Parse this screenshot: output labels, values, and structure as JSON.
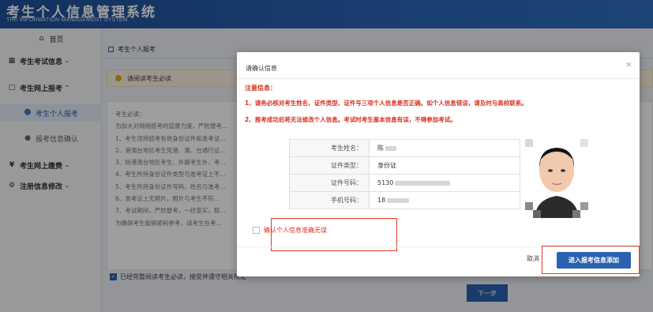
{
  "header": {
    "title_cn": "考生个人信息管理系统",
    "title_en": "THE INFORMATION MANAGEMENT SYSTEM"
  },
  "sidebar": {
    "items": [
      {
        "label": "首页",
        "icon": "home-icon"
      },
      {
        "label": "考生考试信息",
        "icon": "grid-icon"
      },
      {
        "label": "考生网上报考",
        "icon": "monitor-icon"
      },
      {
        "label": "考生个人报考",
        "icon": "user-icon"
      },
      {
        "label": "报考信息确认",
        "icon": "dot-icon"
      },
      {
        "label": "考生网上缴费",
        "icon": "yen-icon"
      },
      {
        "label": "注册信息修改",
        "icon": "gear-icon"
      }
    ]
  },
  "main": {
    "breadcrumb": "考生个人报考",
    "notice": "请阅读考生必读",
    "content_lines": [
      "考生必读：",
      "为加大对网络统考的监督力度，严防替考…",
      "1、考生须持统考有效身份证件和准考证…",
      "2、港澳台地区考生凭港、澳、台通行证…",
      "3、除港澳台地区考生、外籍考生外，考…",
      "4、考生所持身份证件类型与准考证上不…",
      "5、考生所持身份证件号码、姓名与准考…",
      "6、准考证上无照片，照片与考生不符…",
      "7、考试期间，严防替考，一经查实，取…",
      "为确保考生能够顺利参考，请考生在考…"
    ],
    "confirm_read": "已经完整阅读考生必读，接受并遵守相关规定",
    "next_button": "下一步"
  },
  "modal": {
    "title": "请确认信息",
    "attention": "注意信息：",
    "lines": [
      "1、请务必核对考生姓名、证件类型、证件号三项个人信息是否正确。如个人信息错误，请及时与高校联系。",
      "2、报考成功后将无法修改个人信息。考试时考生基本信息有误，不得参加考试。"
    ],
    "fields": [
      {
        "label": "考生姓名：",
        "value": "陈"
      },
      {
        "label": "证件类型：",
        "value": "身份证"
      },
      {
        "label": "证件号码：",
        "value": "5130"
      },
      {
        "label": "手机号码：",
        "value": "18"
      }
    ],
    "confirm_checkbox": "确认个人信息准确无误",
    "cancel_button": "取消",
    "primary_button": "进入报考信息添加",
    "close_glyph": "×"
  }
}
